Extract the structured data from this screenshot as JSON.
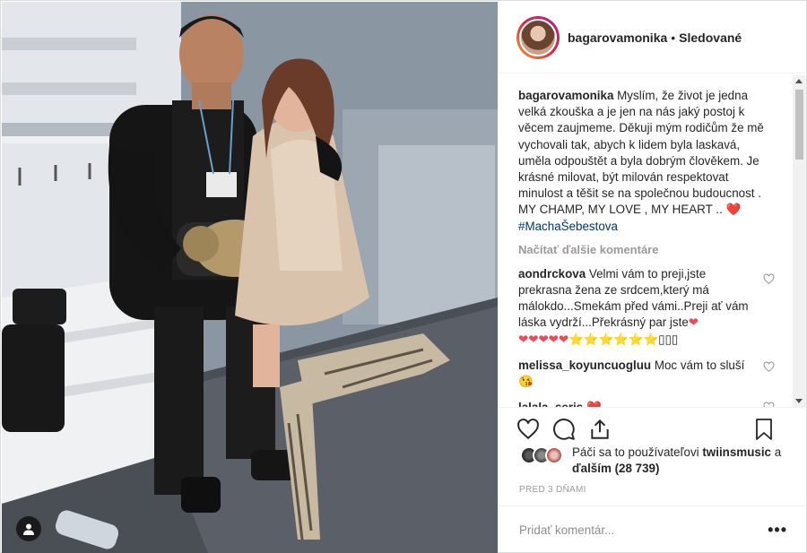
{
  "post": {
    "username": "bagarovamonika",
    "separator": "•",
    "follow_status": "Sledované"
  },
  "caption": {
    "username": "bagarovamonika",
    "text": "Myslím, že život je jedna velká zkouška a je jen na nás jaký postoj k věcem zaujmeme. Děkuji mým rodičům že mě vychovali tak, abych k lidem byla laskavá, uměla odpouštět a byla dobrým člověkem. Je krásné milovat, být milován respektovat minulost a těšit se na společnou budoucnost . MY CHAMP, MY LOVE , MY HEART .. ",
    "heart": "❤️",
    "hashtag": "#MachaŠebestova"
  },
  "load_more_label": "Načítať ďalšie komentáre",
  "comments": [
    {
      "username": "aondrckova",
      "text": "Velmi vám to preji,jste prekrasna žena ze srdcem,který má málokdo...Smekám před vámi..Preji ať vám láska vydrží...Překrásný par jste",
      "hearts": "❤️ ❤️❤️❤️❤️",
      "stars": "⭐⭐⭐⭐⭐⭐",
      "trailing": "▯▯▯"
    },
    {
      "username": "melissa_koyuncuogluu",
      "text": "Moc vám to sluší",
      "emoji": "😘"
    },
    {
      "username": "lalala_seris",
      "text": "",
      "emoji": "❤️"
    }
  ],
  "likes": {
    "prefix": "Páči sa to používateľovi ",
    "user": "twiinsmusic",
    "middle": " a ",
    "others": "ďalším (28 739)"
  },
  "timestamp": "PRED 3 DŇAMI",
  "add_comment": {
    "placeholder": "Pridať komentár...",
    "more": "•••"
  },
  "colors": {
    "username_text": "#262626",
    "muted": "#999999",
    "link": "#003569",
    "heart": "#ed4956",
    "border": "#dbdbdb"
  },
  "icons": {
    "like": "heart-outline-icon",
    "comment": "speech-bubble-icon",
    "share": "share-arrow-icon",
    "save": "bookmark-icon",
    "tag": "user-tag-icon"
  }
}
